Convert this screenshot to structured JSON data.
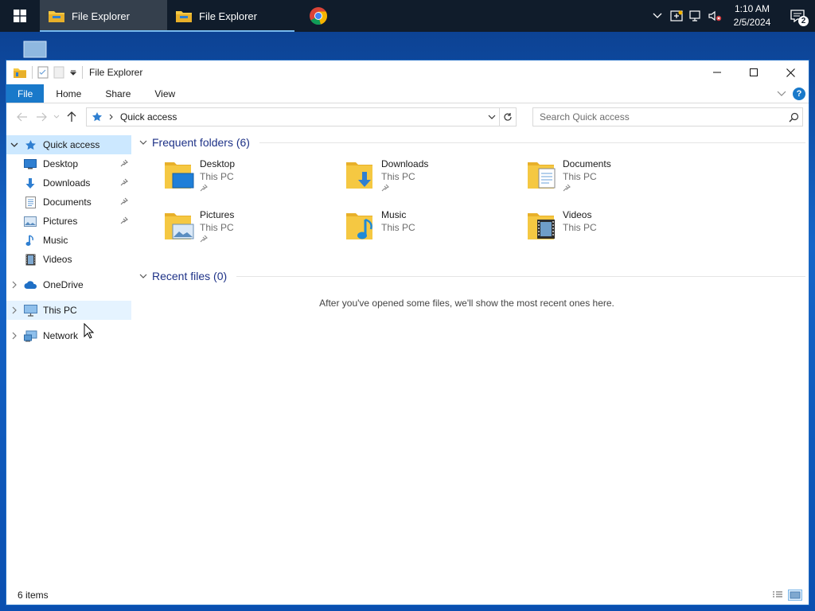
{
  "taskbar": {
    "buttons": [
      {
        "label": "File Explorer"
      },
      {
        "label": "File Explorer"
      }
    ],
    "clock": {
      "time": "1:10 AM",
      "date": "2/5/2024"
    },
    "notification_count": "2"
  },
  "window": {
    "title": "File Explorer",
    "ribbon_tabs": [
      "File",
      "Home",
      "Share",
      "View"
    ],
    "help_label": "?",
    "address": {
      "current": "Quick access"
    },
    "search": {
      "placeholder": "Search Quick access"
    }
  },
  "sidebar": {
    "items": [
      {
        "label": "Quick access",
        "icon": "star-icon"
      },
      {
        "label": "Desktop",
        "icon": "desktop-icon"
      },
      {
        "label": "Downloads",
        "icon": "download-icon"
      },
      {
        "label": "Documents",
        "icon": "document-icon"
      },
      {
        "label": "Pictures",
        "icon": "pictures-icon"
      },
      {
        "label": "Music",
        "icon": "music-icon"
      },
      {
        "label": "Videos",
        "icon": "videos-icon"
      },
      {
        "label": "OneDrive",
        "icon": "cloud-icon"
      },
      {
        "label": "This PC",
        "icon": "computer-icon"
      },
      {
        "label": "Network",
        "icon": "network-icon"
      }
    ]
  },
  "content": {
    "frequent_title": "Frequent folders (6)",
    "folders": [
      {
        "name": "Desktop",
        "location": "This PC",
        "pinned": true
      },
      {
        "name": "Downloads",
        "location": "This PC",
        "pinned": true
      },
      {
        "name": "Documents",
        "location": "This PC",
        "pinned": true
      },
      {
        "name": "Pictures",
        "location": "This PC",
        "pinned": true
      },
      {
        "name": "Music",
        "location": "This PC",
        "pinned": false
      },
      {
        "name": "Videos",
        "location": "This PC",
        "pinned": false
      }
    ],
    "recent_title": "Recent files (0)",
    "recent_empty_message": "After you've opened some files, we'll show the most recent ones here."
  },
  "status": {
    "items_count": "6 items"
  },
  "colors": {
    "accent": "#1979ca",
    "selection": "#cce8ff",
    "taskbar": "#101c2b",
    "folder": "#f5c842"
  }
}
